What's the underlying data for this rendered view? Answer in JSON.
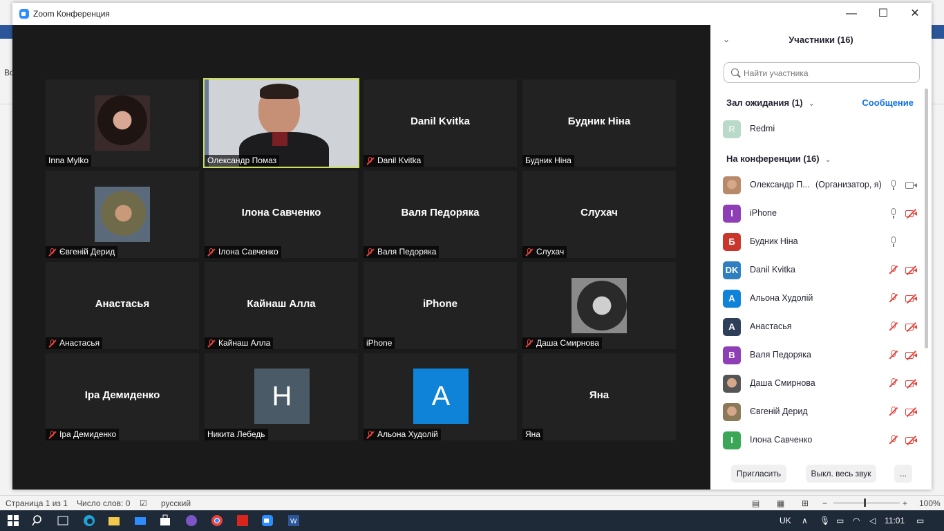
{
  "window": {
    "title": "Zoom Конференция",
    "minimize": "—",
    "maximize": "☐",
    "close": "✕"
  },
  "background_doc": {
    "fragment": "Во"
  },
  "tiles": [
    {
      "name": "Inna Mylko",
      "muted": false,
      "kind": "photo",
      "photo": "woman-dark-hair"
    },
    {
      "name": "Олександр Помаз",
      "muted": false,
      "kind": "video",
      "active": true
    },
    {
      "name": "Danil Kvitka",
      "muted": true,
      "kind": "text"
    },
    {
      "name": "Будник Ніна",
      "muted": false,
      "kind": "text"
    },
    {
      "name": "Євгеній Дерид",
      "muted": true,
      "kind": "photo",
      "photo": "man-cap"
    },
    {
      "name": "Ілона Савченко",
      "muted": true,
      "kind": "text"
    },
    {
      "name": "Валя Педоряка",
      "muted": true,
      "kind": "text"
    },
    {
      "name": "Слухач",
      "muted": true,
      "kind": "text"
    },
    {
      "name": "Анастасья",
      "muted": true,
      "kind": "text"
    },
    {
      "name": "Кайнаш Алла",
      "muted": true,
      "kind": "text"
    },
    {
      "name": "iPhone",
      "muted": false,
      "kind": "text"
    },
    {
      "name": "Даша Смирнова",
      "muted": true,
      "kind": "photo",
      "photo": "woman-bw"
    },
    {
      "name": "Іра Демиденко",
      "muted": true,
      "kind": "text"
    },
    {
      "name": "Никита Лебедь",
      "muted": false,
      "kind": "avatar",
      "letter": "Н",
      "color": "#4a5a66"
    },
    {
      "name": "Альона Худолій",
      "muted": true,
      "kind": "avatar",
      "letter": "A",
      "color": "#0e83d8"
    },
    {
      "name": "Яна",
      "muted": false,
      "kind": "text"
    }
  ],
  "panel": {
    "title": "Участники (16)",
    "search_placeholder": "Найти участника",
    "waiting_room": "Зал ожидания (1)",
    "message_button": "Сообщение",
    "waiting": [
      {
        "name": "Redmi",
        "letter": "R",
        "color": "#b9d9c9"
      }
    ],
    "in_meeting": "На конференции (16)",
    "participants": [
      {
        "name": "Олександр П...",
        "role": "(Организатор, я)",
        "letter": "",
        "color": "#b88a6a",
        "mic": "on",
        "cam": "on"
      },
      {
        "name": "iPhone",
        "letter": "I",
        "color": "#8e3fb5",
        "mic": "on",
        "cam": "off"
      },
      {
        "name": "Будник Ніна",
        "letter": "Б",
        "color": "#c9362b",
        "mic": "on",
        "cam": "none"
      },
      {
        "name": "Danil Kvitka",
        "letter": "DK",
        "color": "#2f7fc0",
        "mic": "off",
        "cam": "off"
      },
      {
        "name": "Альона Худолій",
        "letter": "A",
        "color": "#0e83d8",
        "mic": "off",
        "cam": "off"
      },
      {
        "name": "Анастасья",
        "letter": "A",
        "color": "#2e3f5a",
        "mic": "off",
        "cam": "off"
      },
      {
        "name": "Валя Педоряка",
        "letter": "B",
        "color": "#8e3fb5",
        "mic": "off",
        "cam": "off"
      },
      {
        "name": "Даша Смирнова",
        "letter": "",
        "color": "#555555",
        "mic": "off",
        "cam": "off"
      },
      {
        "name": "Євгеній Дерид",
        "letter": "",
        "color": "#8a7a5a",
        "mic": "off",
        "cam": "off"
      },
      {
        "name": "Ілона Савченко",
        "letter": "I",
        "color": "#3aa757",
        "mic": "off",
        "cam": "off"
      }
    ],
    "invite": "Пригласить",
    "mute_all": "Выкл. весь звук",
    "more": "..."
  },
  "statusbar": {
    "page": "Страница 1 из 1",
    "words": "Число слов: 0",
    "lang": "русский",
    "zoom": "100%"
  },
  "taskbar": {
    "lang": "UK",
    "time": "11:01"
  }
}
